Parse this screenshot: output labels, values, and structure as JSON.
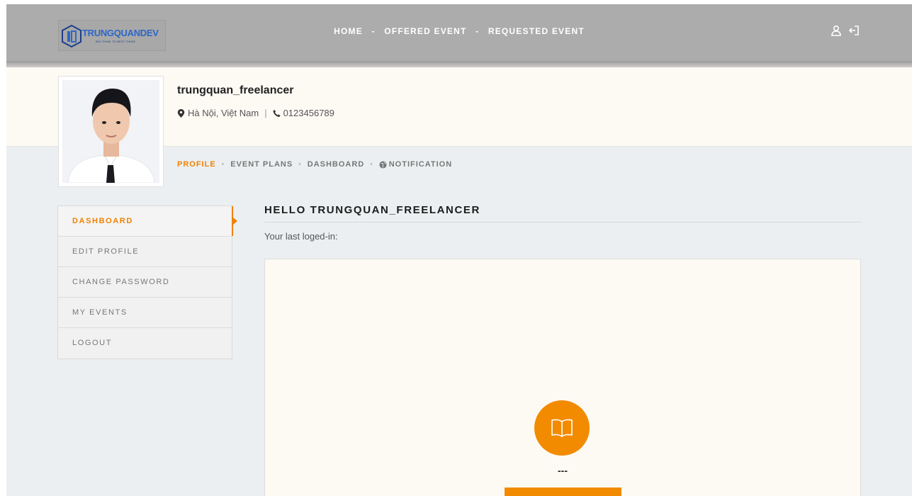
{
  "brand": {
    "name": "TRUNGQUANDEV",
    "tagline": "BIG THINK TO BEST THING",
    "accent": "#f08200"
  },
  "nav": {
    "home": "HOME",
    "separator": "-",
    "offered": "OFFERED EVENT",
    "requested": "REQUESTED EVENT"
  },
  "header_icons": [
    "user-icon",
    "logout-icon"
  ],
  "profile": {
    "username": "trungquan_freelancer",
    "location": "Hà Nội, Việt Nam",
    "phone": "0123456789"
  },
  "subtabs": {
    "profile": "PROFILE",
    "event_plans": "EVENT PLANS",
    "dashboard": "DASHBOARD",
    "notification": "NOTIFICATION"
  },
  "sidebar": {
    "items": [
      {
        "label": "DASHBOARD",
        "active": true
      },
      {
        "label": "EDIT PROFILE"
      },
      {
        "label": "CHANGE PASSWORD"
      },
      {
        "label": "MY EVENTS"
      },
      {
        "label": "LOGOUT"
      }
    ]
  },
  "main": {
    "greeting": "HELLO TRUNGQUAN_FREELANCER",
    "last_login_label": "Your last loged-in:",
    "panel_value": "---"
  }
}
